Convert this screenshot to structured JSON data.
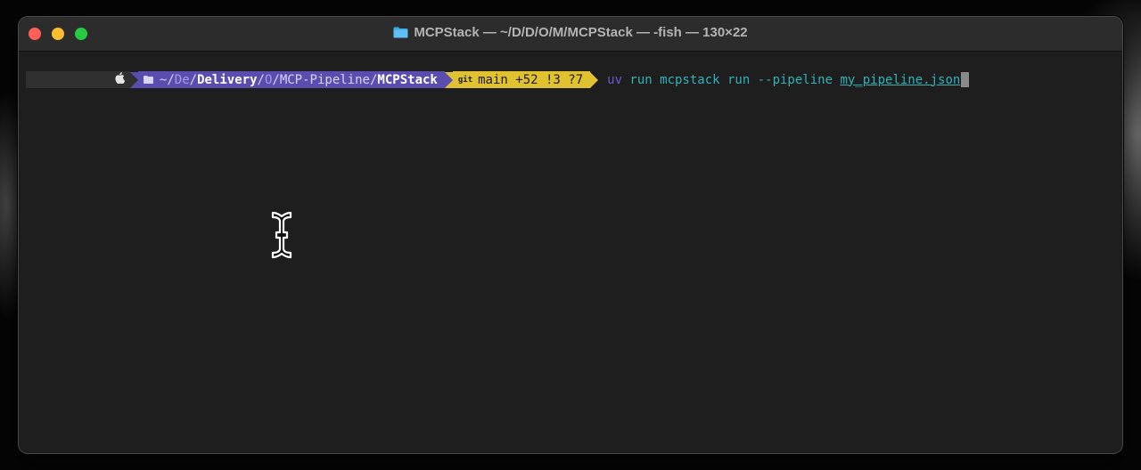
{
  "window": {
    "title": "MCPStack — ~/D/D/O/M/MCPStack — -fish — 130×22",
    "title_icon": "folder-icon"
  },
  "colors": {
    "close": "#ff5f57",
    "minimize": "#febc2e",
    "maximize": "#28c840",
    "dir_segment": "#5a4db0",
    "git_segment": "#e0c230",
    "command": "#2fb3b8",
    "command_uv": "#6a5acd"
  },
  "prompt": {
    "os_icon": "apple-icon",
    "dir_icon": "folder-icon",
    "dir_parts": {
      "home": "~/",
      "p1": "De",
      "sep1": "/",
      "p2": "Delivery",
      "sep2": "/",
      "p3": "O",
      "sep3": "/",
      "p4": "MCP-Pipeline",
      "sep4": "/",
      "p5": "MCPStack"
    },
    "git_icon_text": "git",
    "git_status": "main +52 !3 ?7"
  },
  "command": {
    "uv": "uv",
    "rest": " run mcpstack run --pipeline ",
    "arg": "my_pipeline.json"
  }
}
